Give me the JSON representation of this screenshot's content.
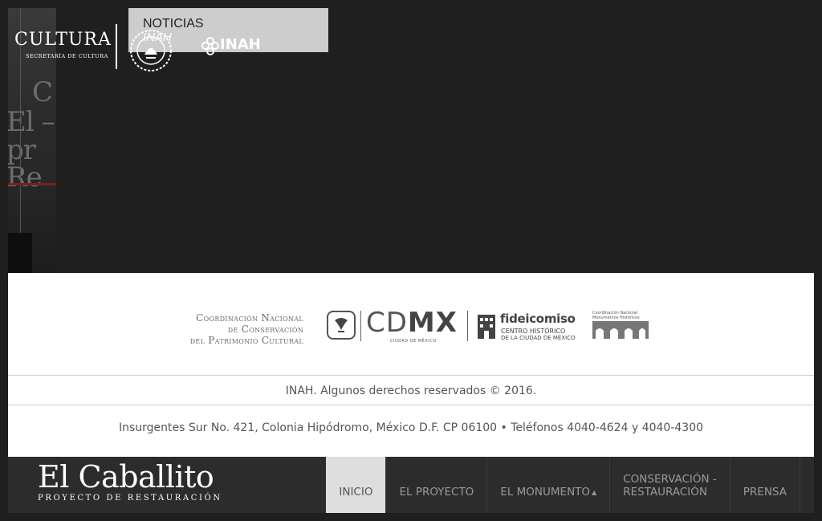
{
  "header": {
    "cultura_logo": {
      "name": "CULTURA",
      "subtitle": "SECRETARÍA DE CULTURA"
    },
    "inah_logo": {
      "name": "INAH"
    },
    "news_box": {
      "title": "NOTICIAS",
      "source": "INAH"
    }
  },
  "footer": {
    "partners": {
      "cncpc": [
        "Coordinación Nacional",
        "de Conservación",
        "del Patrimonio Cultural"
      ],
      "cdmx": {
        "light": "CD",
        "bold": "MX",
        "sub": "CIUDAD DE MÉXICO"
      },
      "fideicomiso": {
        "name": "fideicomiso",
        "sub1": "CENTRO HISTÓRICO",
        "sub2": "DE LA CIUDAD DE MÉXICO"
      },
      "cnmh": [
        "Coordinación Nacional",
        "Monumentos Históricos"
      ]
    },
    "copyright": "INAH. Algunos derechos reservados © 2016.",
    "address": "Insurgentes Sur No. 421, Colonia Hipódromo, México D.F. CP 06100 • Teléfonos 4040-4624 y 4040-4300"
  },
  "navbar": {
    "brand_title": "El Caballito",
    "brand_subtitle": "PROYECTO DE RESTAURACIÓN",
    "items": [
      {
        "label": "INICIO",
        "active": true
      },
      {
        "label": "EL PROYECTO"
      },
      {
        "label": "EL MONUMENTO",
        "caret": "▲"
      },
      {
        "label_line1": "CONSERVACIÓN -",
        "label_line2": "RESTAURACIÓN"
      },
      {
        "label": "PRENSA"
      }
    ]
  },
  "colors": {
    "background": "#1f1f20",
    "navbar": "#2c2c2d",
    "active_nav": "#dedede",
    "footer": "#ffffff"
  }
}
